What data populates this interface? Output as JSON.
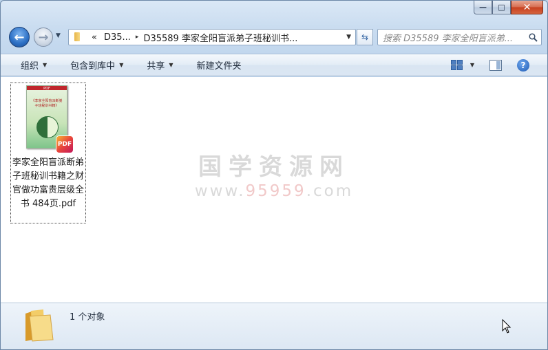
{
  "window": {
    "caption_min": "—",
    "caption_max": "□",
    "caption_close": "✕"
  },
  "nav": {
    "back_glyph": "←",
    "forward_glyph": "→",
    "history_glyph": "▼"
  },
  "address": {
    "prefix": "«",
    "segment_1": "D35...",
    "separator": "▸",
    "segment_2": "D35589 李家全阳盲派弟子班秘训书...",
    "dropdown": "▼",
    "refresh_glyph": "⇆"
  },
  "search": {
    "placeholder": "搜索 D35589 李家全阳盲派弟..."
  },
  "toolbar": {
    "organize": "组织",
    "include_library": "包含到库中",
    "share": "共享",
    "new_folder": "新建文件夹",
    "caret": "▼",
    "help": "?"
  },
  "file": {
    "name": "李家全阳盲派断弟子班秘训书籍之财官做功富贵层级全书 484页.pdf",
    "badge": "PDF",
    "thumb_tag": "PDF",
    "thumb_title": "《李家全阳盲派断弟子班秘训书籍》"
  },
  "watermark": {
    "title": "国学资源网",
    "url_prefix": "www.",
    "url_number": "95959",
    "url_suffix": ".com"
  },
  "status": {
    "count": "1 个对象"
  },
  "colors": {
    "accent": "#2c6fc4",
    "toolbar_bg": "#dbe6f3",
    "window_frame": "#c2d7ee"
  }
}
